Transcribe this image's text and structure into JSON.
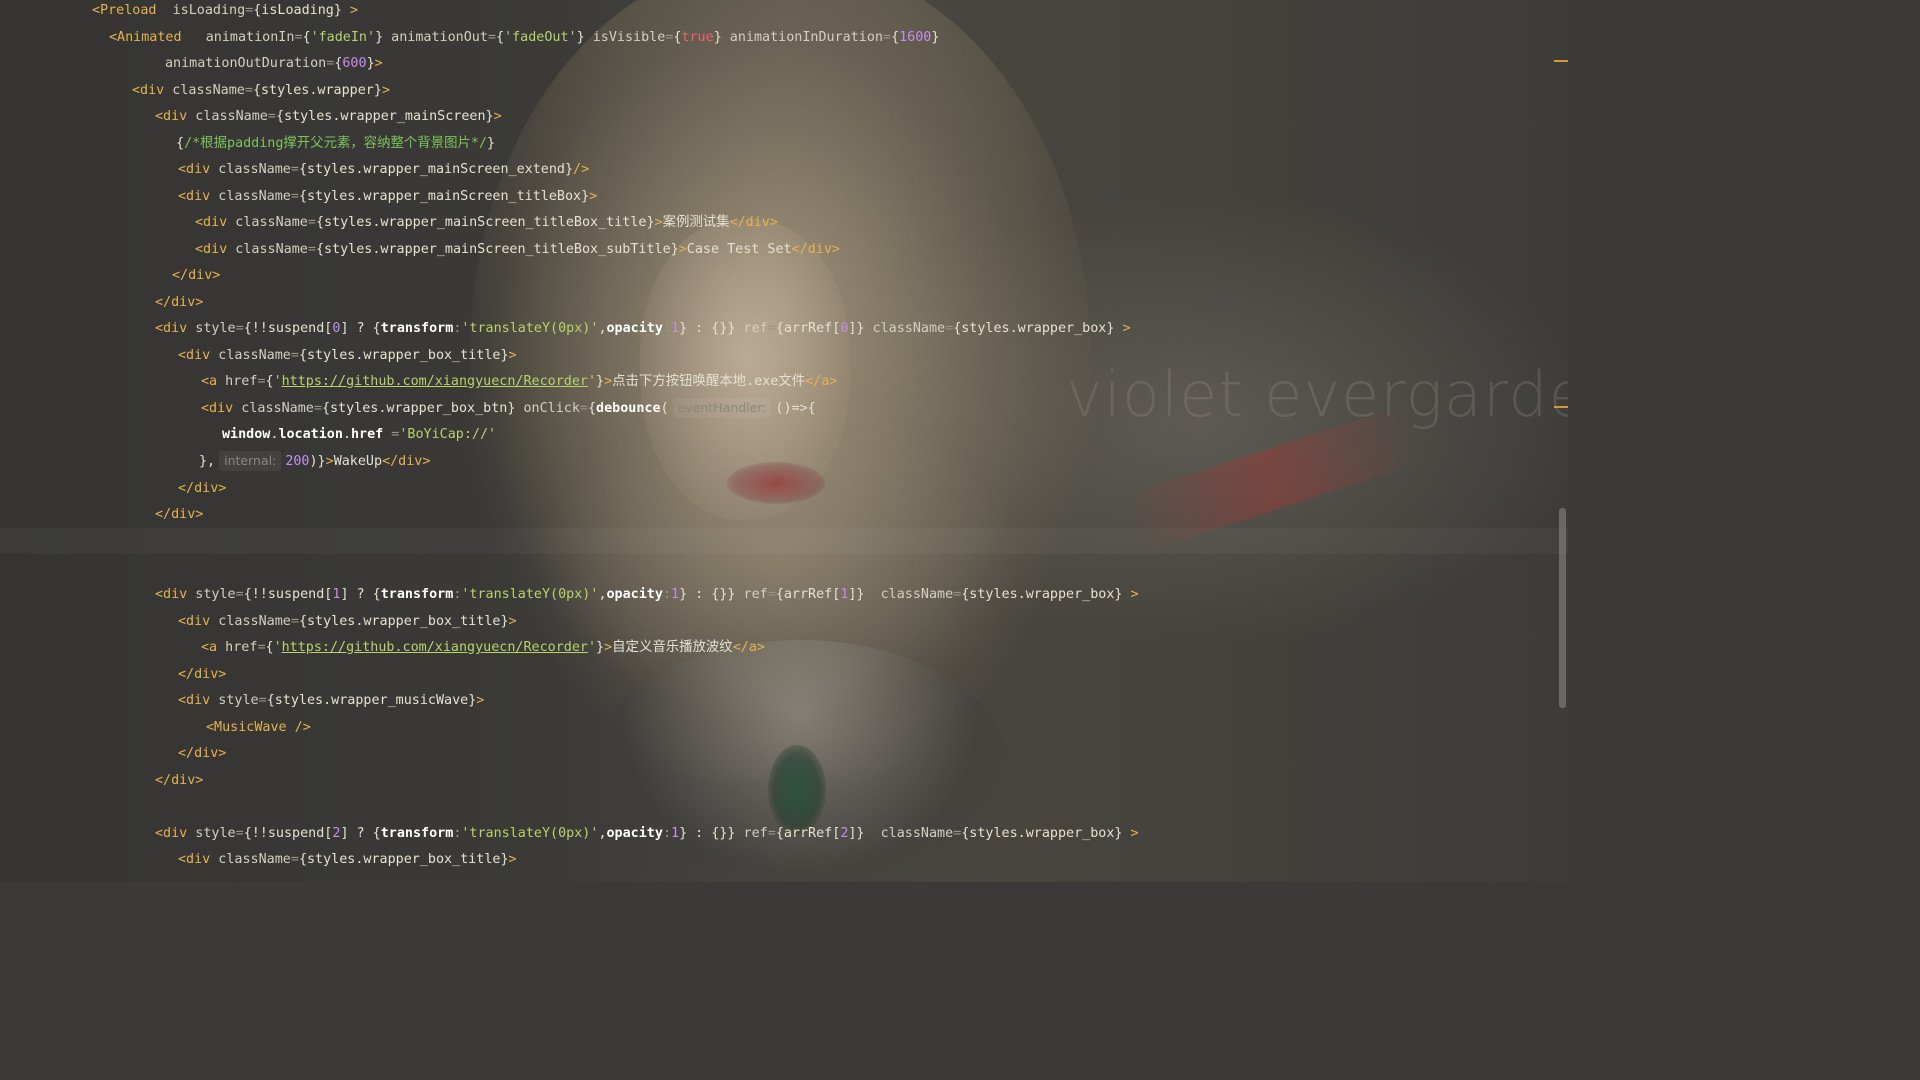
{
  "background": {
    "watermark_text": "violet evergarden",
    "palette": {
      "base": "#3b3a38",
      "hair": "#c8b694",
      "lips": "#963237",
      "ribbon": "#963c37",
      "brooch": "#285040"
    }
  },
  "theme": {
    "tag_color": "#e6b34a",
    "string_color": "#b7d36a",
    "number_color": "#c68cf0",
    "keyword_color": "#f0606b",
    "comment_color": "#7cc45a"
  },
  "lines": [
    {
      "t": 11,
      "indent": 92,
      "tokens": [
        {
          "c": "tag",
          "v": "<Preload"
        },
        {
          "c": "attr",
          "v": "  isLoading"
        },
        {
          "c": "op",
          "v": "="
        },
        {
          "c": "ident",
          "v": "{isLoading}"
        },
        {
          "c": "tag",
          "v": " >"
        }
      ]
    },
    {
      "t": 38,
      "indent": 109,
      "tokens": [
        {
          "c": "tag",
          "v": "<Animated"
        },
        {
          "c": "attr",
          "v": "   animationIn"
        },
        {
          "c": "op",
          "v": "="
        },
        {
          "c": "ident",
          "v": "{"
        },
        {
          "c": "str",
          "v": "'fadeIn'"
        },
        {
          "c": "ident",
          "v": "}"
        },
        {
          "c": "attr",
          "v": " animationOut"
        },
        {
          "c": "op",
          "v": "="
        },
        {
          "c": "ident",
          "v": "{"
        },
        {
          "c": "str",
          "v": "'fadeOut'"
        },
        {
          "c": "ident",
          "v": "}"
        },
        {
          "c": "attr",
          "v": " isVisible"
        },
        {
          "c": "op",
          "v": "="
        },
        {
          "c": "ident",
          "v": "{"
        },
        {
          "c": "kw",
          "v": "true"
        },
        {
          "c": "ident",
          "v": "}"
        },
        {
          "c": "attr",
          "v": " animationInDuration"
        },
        {
          "c": "op",
          "v": "="
        },
        {
          "c": "ident",
          "v": "{"
        },
        {
          "c": "num",
          "v": "1600"
        },
        {
          "c": "ident",
          "v": "}"
        }
      ]
    },
    {
      "t": 64,
      "indent": 165,
      "tokens": [
        {
          "c": "attr",
          "v": "animationOutDuration"
        },
        {
          "c": "op",
          "v": "="
        },
        {
          "c": "ident",
          "v": "{"
        },
        {
          "c": "num",
          "v": "600"
        },
        {
          "c": "ident",
          "v": "}"
        },
        {
          "c": "tag",
          "v": ">"
        }
      ]
    },
    {
      "t": 91,
      "indent": 132,
      "tokens": [
        {
          "c": "tag",
          "v": "<div"
        },
        {
          "c": "attr",
          "v": " className"
        },
        {
          "c": "op",
          "v": "="
        },
        {
          "c": "ident",
          "v": "{styles.wrapper}"
        },
        {
          "c": "tag",
          "v": ">"
        }
      ]
    },
    {
      "t": 117,
      "indent": 155,
      "tokens": [
        {
          "c": "tag",
          "v": "<div"
        },
        {
          "c": "attr",
          "v": " className"
        },
        {
          "c": "op",
          "v": "="
        },
        {
          "c": "ident",
          "v": "{styles.wrapper_mainScreen}"
        },
        {
          "c": "tag",
          "v": ">"
        }
      ]
    },
    {
      "t": 144,
      "indent": 176,
      "tokens": [
        {
          "c": "ident",
          "v": "{"
        },
        {
          "c": "cmt",
          "v": "/*根据padding撑开父元素，容纳整个背景图片*/"
        },
        {
          "c": "ident",
          "v": "}"
        }
      ]
    },
    {
      "t": 170,
      "indent": 178,
      "tokens": [
        {
          "c": "tag",
          "v": "<div"
        },
        {
          "c": "attr",
          "v": " className"
        },
        {
          "c": "op",
          "v": "="
        },
        {
          "c": "ident",
          "v": "{styles.wrapper_mainScreen_extend}"
        },
        {
          "c": "tag",
          "v": "/>"
        }
      ]
    },
    {
      "t": 197,
      "indent": 178,
      "tokens": [
        {
          "c": "tag",
          "v": "<div"
        },
        {
          "c": "attr",
          "v": " className"
        },
        {
          "c": "op",
          "v": "="
        },
        {
          "c": "ident",
          "v": "{styles.wrapper_mainScreen_titleBox}"
        },
        {
          "c": "tag",
          "v": ">"
        }
      ]
    },
    {
      "t": 223,
      "indent": 195,
      "tokens": [
        {
          "c": "tag",
          "v": "<div"
        },
        {
          "c": "attr",
          "v": " className"
        },
        {
          "c": "op",
          "v": "="
        },
        {
          "c": "ident",
          "v": "{styles.wrapper_mainScreen_titleBox_title}"
        },
        {
          "c": "tag",
          "v": ">"
        },
        {
          "c": "txt",
          "v": "案例测试集"
        },
        {
          "c": "tag",
          "v": "</div>"
        }
      ]
    },
    {
      "t": 250,
      "indent": 195,
      "tokens": [
        {
          "c": "tag",
          "v": "<div"
        },
        {
          "c": "attr",
          "v": " className"
        },
        {
          "c": "op",
          "v": "="
        },
        {
          "c": "ident",
          "v": "{styles.wrapper_mainScreen_titleBox_subTitle}"
        },
        {
          "c": "tag",
          "v": ">"
        },
        {
          "c": "txt",
          "v": "Case Test Set"
        },
        {
          "c": "tag",
          "v": "</div>"
        }
      ]
    },
    {
      "t": 276,
      "indent": 172,
      "tokens": [
        {
          "c": "tag",
          "v": "</div>"
        }
      ]
    },
    {
      "t": 303,
      "indent": 155,
      "tokens": [
        {
          "c": "tag",
          "v": "</div>"
        }
      ]
    },
    {
      "t": 329,
      "indent": 155,
      "tokens": [
        {
          "c": "tag",
          "v": "<div"
        },
        {
          "c": "attr",
          "v": " style"
        },
        {
          "c": "op",
          "v": "="
        },
        {
          "c": "ident",
          "v": "{!!suspend["
        },
        {
          "c": "num",
          "v": "0"
        },
        {
          "c": "ident",
          "v": "] ? {"
        },
        {
          "c": "bold",
          "v": "transform"
        },
        {
          "c": "op",
          "v": ":"
        },
        {
          "c": "str",
          "v": "'translateY(0px)'"
        },
        {
          "c": "ident",
          "v": ","
        },
        {
          "c": "bold",
          "v": "opacity"
        },
        {
          "c": "op",
          "v": ":"
        },
        {
          "c": "num",
          "v": "1"
        },
        {
          "c": "ident",
          "v": "} : {}}"
        },
        {
          "c": "attr",
          "v": " ref"
        },
        {
          "c": "op",
          "v": "="
        },
        {
          "c": "ident",
          "v": "{arrRef["
        },
        {
          "c": "num",
          "v": "0"
        },
        {
          "c": "ident",
          "v": "]}"
        },
        {
          "c": "attr",
          "v": " className"
        },
        {
          "c": "op",
          "v": "="
        },
        {
          "c": "ident",
          "v": "{styles.wrapper_box}"
        },
        {
          "c": "tag",
          "v": " >"
        }
      ]
    },
    {
      "t": 356,
      "indent": 178,
      "tokens": [
        {
          "c": "tag",
          "v": "<div"
        },
        {
          "c": "attr",
          "v": " className"
        },
        {
          "c": "op",
          "v": "="
        },
        {
          "c": "ident",
          "v": "{styles.wrapper_box_title}"
        },
        {
          "c": "tag",
          "v": ">"
        }
      ]
    },
    {
      "t": 382,
      "indent": 201,
      "tokens": [
        {
          "c": "tag",
          "v": "<a"
        },
        {
          "c": "attr",
          "v": " href"
        },
        {
          "c": "op",
          "v": "="
        },
        {
          "c": "ident",
          "v": "{"
        },
        {
          "c": "str",
          "v": "'"
        },
        {
          "c": "url",
          "v": "https://github.com/xiangyuecn/Recorder"
        },
        {
          "c": "str",
          "v": "'"
        },
        {
          "c": "ident",
          "v": "}"
        },
        {
          "c": "tag",
          "v": ">"
        },
        {
          "c": "txt",
          "v": "点击下方按钮唤醒本地.exe文件"
        },
        {
          "c": "tag",
          "v": "</a>"
        }
      ]
    },
    {
      "t": 409,
      "indent": 201,
      "tokens": [
        {
          "c": "tag",
          "v": "<div"
        },
        {
          "c": "attr",
          "v": " className"
        },
        {
          "c": "op",
          "v": "="
        },
        {
          "c": "ident",
          "v": "{styles.wrapper_box_btn}"
        },
        {
          "c": "attr",
          "v": " onClick"
        },
        {
          "c": "op",
          "v": "="
        },
        {
          "c": "ident",
          "v": "{"
        },
        {
          "c": "bold",
          "v": "debounce"
        },
        {
          "c": "ident",
          "v": "("
        },
        {
          "c": "hint",
          "v": "eventHandler:"
        },
        {
          "c": "ident",
          "v": "()=>{"
        }
      ]
    },
    {
      "t": 435,
      "indent": 222,
      "tokens": [
        {
          "c": "bold",
          "v": "window"
        },
        {
          "c": "ident",
          "v": "."
        },
        {
          "c": "bold",
          "v": "location"
        },
        {
          "c": "ident",
          "v": "."
        },
        {
          "c": "bold",
          "v": "href"
        },
        {
          "c": "op",
          "v": " ="
        },
        {
          "c": "str",
          "v": "'BoYiCap://'"
        }
      ]
    },
    {
      "t": 462,
      "indent": 199,
      "tokens": [
        {
          "c": "ident",
          "v": "},"
        },
        {
          "c": "hint",
          "v": "internal:"
        },
        {
          "c": "num",
          "v": "200"
        },
        {
          "c": "ident",
          "v": ")}"
        },
        {
          "c": "tag",
          "v": ">"
        },
        {
          "c": "txt",
          "v": "WakeUp"
        },
        {
          "c": "tag",
          "v": "</div>"
        }
      ]
    },
    {
      "t": 489,
      "indent": 178,
      "tokens": [
        {
          "c": "tag",
          "v": "</div>"
        }
      ]
    },
    {
      "t": 515,
      "indent": 155,
      "tokens": [
        {
          "c": "tag",
          "v": "</div>"
        }
      ]
    },
    {
      "t": 595,
      "indent": 155,
      "tokens": [
        {
          "c": "tag",
          "v": "<div"
        },
        {
          "c": "attr",
          "v": " style"
        },
        {
          "c": "op",
          "v": "="
        },
        {
          "c": "ident",
          "v": "{!!suspend["
        },
        {
          "c": "num",
          "v": "1"
        },
        {
          "c": "ident",
          "v": "] ? {"
        },
        {
          "c": "bold",
          "v": "transform"
        },
        {
          "c": "op",
          "v": ":"
        },
        {
          "c": "str",
          "v": "'translateY(0px)'"
        },
        {
          "c": "ident",
          "v": ","
        },
        {
          "c": "bold",
          "v": "opacity"
        },
        {
          "c": "op",
          "v": ":"
        },
        {
          "c": "num",
          "v": "1"
        },
        {
          "c": "ident",
          "v": "} : {}}"
        },
        {
          "c": "attr",
          "v": " ref"
        },
        {
          "c": "op",
          "v": "="
        },
        {
          "c": "ident",
          "v": "{arrRef["
        },
        {
          "c": "num",
          "v": "1"
        },
        {
          "c": "ident",
          "v": "]}"
        },
        {
          "c": "attr",
          "v": "  className"
        },
        {
          "c": "op",
          "v": "="
        },
        {
          "c": "ident",
          "v": "{styles.wrapper_box}"
        },
        {
          "c": "tag",
          "v": " >"
        }
      ]
    },
    {
      "t": 622,
      "indent": 178,
      "tokens": [
        {
          "c": "tag",
          "v": "<div"
        },
        {
          "c": "attr",
          "v": " className"
        },
        {
          "c": "op",
          "v": "="
        },
        {
          "c": "ident",
          "v": "{styles.wrapper_box_title}"
        },
        {
          "c": "tag",
          "v": ">"
        }
      ]
    },
    {
      "t": 648,
      "indent": 201,
      "tokens": [
        {
          "c": "tag",
          "v": "<a"
        },
        {
          "c": "attr",
          "v": " href"
        },
        {
          "c": "op",
          "v": "="
        },
        {
          "c": "ident",
          "v": "{"
        },
        {
          "c": "str",
          "v": "'"
        },
        {
          "c": "url",
          "v": "https://github.com/xiangyuecn/Recorder"
        },
        {
          "c": "str",
          "v": "'"
        },
        {
          "c": "ident",
          "v": "}"
        },
        {
          "c": "tag",
          "v": ">"
        },
        {
          "c": "txt",
          "v": "自定义音乐播放波纹"
        },
        {
          "c": "tag",
          "v": "</a>"
        }
      ]
    },
    {
      "t": 675,
      "indent": 178,
      "tokens": [
        {
          "c": "tag",
          "v": "</div>"
        }
      ]
    },
    {
      "t": 701,
      "indent": 178,
      "tokens": [
        {
          "c": "tag",
          "v": "<div"
        },
        {
          "c": "attr",
          "v": " style"
        },
        {
          "c": "op",
          "v": "="
        },
        {
          "c": "ident",
          "v": "{styles.wrapper_musicWave}"
        },
        {
          "c": "tag",
          "v": ">"
        }
      ]
    },
    {
      "t": 728,
      "indent": 206,
      "tokens": [
        {
          "c": "tag",
          "v": "<MusicWave />"
        }
      ]
    },
    {
      "t": 754,
      "indent": 178,
      "tokens": [
        {
          "c": "tag",
          "v": "</div>"
        }
      ]
    },
    {
      "t": 781,
      "indent": 155,
      "tokens": [
        {
          "c": "tag",
          "v": "</div>"
        }
      ]
    },
    {
      "t": 834,
      "indent": 155,
      "tokens": [
        {
          "c": "tag",
          "v": "<div"
        },
        {
          "c": "attr",
          "v": " style"
        },
        {
          "c": "op",
          "v": "="
        },
        {
          "c": "ident",
          "v": "{!!suspend["
        },
        {
          "c": "num",
          "v": "2"
        },
        {
          "c": "ident",
          "v": "] ? {"
        },
        {
          "c": "bold",
          "v": "transform"
        },
        {
          "c": "op",
          "v": ":"
        },
        {
          "c": "str",
          "v": "'translateY(0px)'"
        },
        {
          "c": "ident",
          "v": ","
        },
        {
          "c": "bold",
          "v": "opacity"
        },
        {
          "c": "op",
          "v": ":"
        },
        {
          "c": "num",
          "v": "1"
        },
        {
          "c": "ident",
          "v": "} : {}}"
        },
        {
          "c": "attr",
          "v": " ref"
        },
        {
          "c": "op",
          "v": "="
        },
        {
          "c": "ident",
          "v": "{arrRef["
        },
        {
          "c": "num",
          "v": "2"
        },
        {
          "c": "ident",
          "v": "]}"
        },
        {
          "c": "attr",
          "v": "  className"
        },
        {
          "c": "op",
          "v": "="
        },
        {
          "c": "ident",
          "v": "{styles.wrapper_box}"
        },
        {
          "c": "tag",
          "v": " >"
        }
      ]
    },
    {
      "t": 860,
      "indent": 178,
      "tokens": [
        {
          "c": "tag",
          "v": "<div"
        },
        {
          "c": "attr",
          "v": " className"
        },
        {
          "c": "op",
          "v": "="
        },
        {
          "c": "ident",
          "v": "{styles.wrapper_box_title}"
        },
        {
          "c": "tag",
          "v": ">"
        }
      ]
    }
  ]
}
